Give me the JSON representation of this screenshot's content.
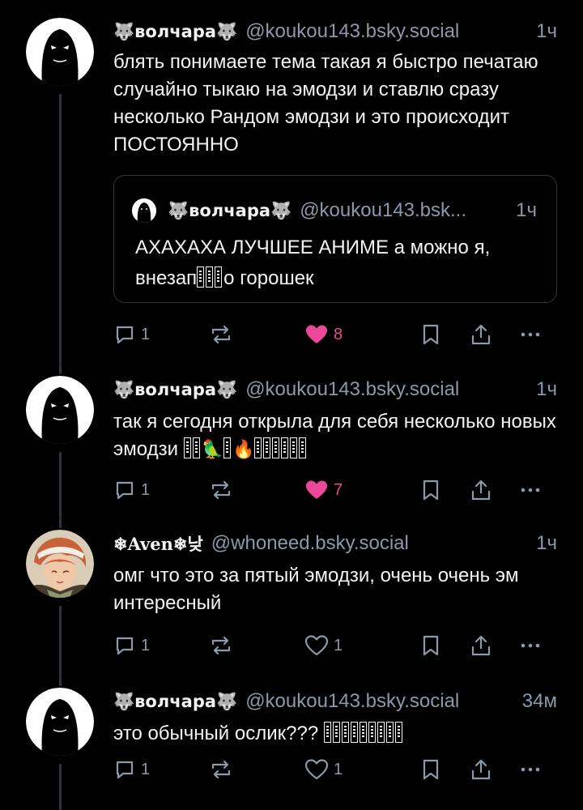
{
  "posts": [
    {
      "display_name": "🐺волчара🐺",
      "handle": "@koukou143.bsky.social",
      "time": "1ч",
      "text": "блять понимаете тема такая я быстро печатаю случайно тыкаю на эмодзи и ставлю сразу несколько Рандом эмодзи и это происходит ПОСТОЯННО",
      "quote": {
        "display_name": "🐺волчара🐺",
        "handle": "@koukou143.bsk...",
        "time": "1ч",
        "text_before": "АХАХАХА ЛУЧШЕЕ АНИМЕ а можно я, внезап",
        "text_after": "о горошек"
      },
      "replies": "1",
      "reposts": "",
      "likes": "8",
      "liked": true
    },
    {
      "display_name": "🐺волчара🐺",
      "handle": "@koukou143.bsky.social",
      "time": "1ч",
      "text_before": "так я сегодня открыла для себя несколько новых эмодзи",
      "emoji_bird": "🦜",
      "emoji_fire": "🔥",
      "replies": "1",
      "reposts": "",
      "likes": "7",
      "liked": true
    },
    {
      "display_name": "❄Aven❄낮",
      "handle": "@whoneed.bsky.social",
      "time": "1ч",
      "text": "омг что это за пятый эмодзи, очень очень эм интересный",
      "replies": "1",
      "reposts": "",
      "likes": "1",
      "liked": false
    },
    {
      "display_name": "🐺волчара🐺",
      "handle": "@koukou143.bsky.social",
      "time": "34м",
      "text": "это обычный ослик???",
      "replies": "1",
      "reposts": "",
      "likes": "1",
      "liked": false
    }
  ],
  "colors": {
    "background": "#000000",
    "text": "#f1f3f5",
    "muted": "#8d99a8",
    "like_active": "#ec4899",
    "thread_line": "#2e3440"
  }
}
